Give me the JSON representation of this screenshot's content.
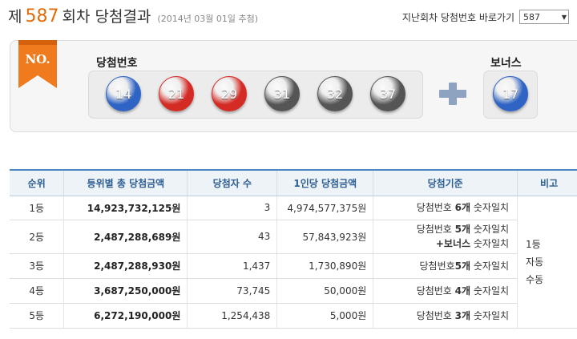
{
  "header": {
    "prefix": "제",
    "round": "587",
    "suffix": "회차 당첨결과",
    "draw_date": "(2014년 03월 01일 추첨)"
  },
  "nav": {
    "label": "지난회차 당첨번호 바로가기",
    "select_value": "587"
  },
  "result": {
    "ribbon_text": "NO.",
    "main_label": "당첨번호",
    "bonus_label": "보너스",
    "numbers": [
      {
        "value": "14",
        "color": "#2f63c4"
      },
      {
        "value": "21",
        "color": "#d42b25"
      },
      {
        "value": "29",
        "color": "#d42b25"
      },
      {
        "value": "31",
        "color": "#555555"
      },
      {
        "value": "32",
        "color": "#555555"
      },
      {
        "value": "37",
        "color": "#555555"
      }
    ],
    "bonus": {
      "value": "17",
      "color": "#2f63c4"
    }
  },
  "table": {
    "headers": [
      "순위",
      "등위별 총 당첨금액",
      "당첨자 수",
      "1인당 당첨금액",
      "당첨기준",
      "비고"
    ],
    "rows": [
      {
        "rank": "1등",
        "total": "14,923,732,125원",
        "winners": "3",
        "per": "4,974,577,375원",
        "crit_a": "당첨번호 ",
        "crit_b": "6개",
        "crit_c": " 숫자일치",
        "crit_d": "",
        "crit_e": ""
      },
      {
        "rank": "2등",
        "total": "2,487,288,689원",
        "winners": "43",
        "per": "57,843,923원",
        "crit_a": "당첨번호 ",
        "crit_b": "5개",
        "crit_c": " 숫자일치",
        "crit_d": "+보너스",
        "crit_e": " 숫자일치"
      },
      {
        "rank": "3등",
        "total": "2,487,288,930원",
        "winners": "1,437",
        "per": "1,730,890원",
        "crit_a": "당첨번호",
        "crit_b": "5개",
        "crit_c": " 숫자일치",
        "crit_d": "",
        "crit_e": ""
      },
      {
        "rank": "4등",
        "total": "3,687,250,000원",
        "winners": "73,745",
        "per": "50,000원",
        "crit_a": "당첨번호 ",
        "crit_b": "4개",
        "crit_c": " 숫자일치",
        "crit_d": "",
        "crit_e": ""
      },
      {
        "rank": "5등",
        "total": "6,272,190,000원",
        "winners": "1,254,438",
        "per": "5,000원",
        "crit_a": "당첨번호 ",
        "crit_b": "3개",
        "crit_c": " 숫자일치",
        "crit_d": "",
        "crit_e": ""
      }
    ],
    "note_lines": [
      "1등",
      "자동",
      "수동"
    ]
  }
}
